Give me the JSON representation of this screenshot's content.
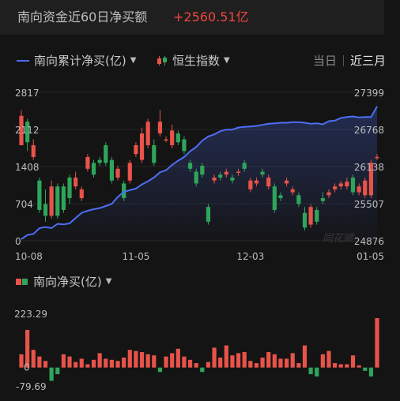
{
  "header": {
    "title": "南向资金近60日净买额",
    "value": "+2560.51亿"
  },
  "legend": {
    "line_label": "南向累计净买(亿)",
    "candle_label": "恒生指数",
    "bar_label": "南向净买(亿)"
  },
  "tabs": [
    {
      "label": "当日",
      "active": false
    },
    {
      "label": "近三月",
      "active": true
    }
  ],
  "watermark": "同花顺",
  "colors": {
    "line": "#4d6ef5",
    "up": "#e8534a",
    "down": "#2fa55c",
    "background": "#141414"
  },
  "chart_data": [
    {
      "type": "line",
      "name": "南向累计净买(亿)",
      "ylim": [
        0,
        2817
      ],
      "left_ticks": [
        "2817",
        "2112",
        "1408",
        "704",
        "0"
      ],
      "x_ticks": [
        "10-08",
        "11-05",
        "12-03",
        "01-05"
      ],
      "x_tick_index": [
        0,
        19,
        38,
        59
      ],
      "values": [
        30,
        110,
        130,
        240,
        260,
        240,
        320,
        310,
        330,
        430,
        530,
        570,
        600,
        620,
        660,
        700,
        830,
        930,
        960,
        990,
        1070,
        1130,
        1200,
        1300,
        1340,
        1440,
        1520,
        1590,
        1700,
        1780,
        1900,
        1980,
        2020,
        2080,
        2110,
        2110,
        2150,
        2160,
        2170,
        2180,
        2200,
        2220,
        2230,
        2240,
        2240,
        2250,
        2250,
        2240,
        2220,
        2230,
        2210,
        2270,
        2280,
        2330,
        2350,
        2360,
        2340,
        2350,
        2350,
        2550
      ]
    },
    {
      "type": "candlestick",
      "name": "恒生指数",
      "ylim": [
        24876,
        27399
      ],
      "right_ticks": [
        "27399",
        "26768",
        "26138",
        "25507",
        "24876"
      ],
      "ohlc": [
        [
          26500,
          27000,
          26550,
          27100
        ],
        [
          26900,
          26550,
          26400,
          26950
        ],
        [
          26300,
          26500,
          26250,
          26600
        ],
        [
          25900,
          25400,
          25350,
          25950
        ],
        [
          25500,
          25300,
          25200,
          25750
        ],
        [
          25300,
          25800,
          25250,
          25900
        ],
        [
          25800,
          25300,
          25250,
          25850
        ],
        [
          25800,
          25400,
          25350,
          25850
        ],
        [
          25950,
          25600,
          25500,
          26000
        ],
        [
          25800,
          25950,
          25750,
          26050
        ],
        [
          25600,
          25750,
          25550,
          25800
        ],
        [
          26100,
          26300,
          26050,
          26350
        ],
        [
          26200,
          26000,
          25950,
          26250
        ],
        [
          26250,
          26200,
          26150,
          26300
        ],
        [
          26500,
          26200,
          26150,
          26550
        ],
        [
          26250,
          25900,
          25850,
          26300
        ],
        [
          25950,
          26100,
          25900,
          26150
        ],
        [
          25850,
          25600,
          25550,
          25900
        ],
        [
          25900,
          26200,
          25850,
          26250
        ],
        [
          26350,
          26500,
          26300,
          26550
        ],
        [
          26250,
          26700,
          26200,
          26800
        ],
        [
          26500,
          26900,
          26450,
          26950
        ],
        [
          26500,
          26200,
          26150,
          26600
        ],
        [
          26700,
          26900,
          26650,
          27100
        ],
        [
          26600,
          26600,
          26550,
          26650
        ],
        [
          26500,
          26750,
          26450,
          26850
        ],
        [
          26700,
          26550,
          26500,
          26750
        ],
        [
          26600,
          26400,
          26350,
          26650
        ],
        [
          26200,
          26100,
          26050,
          26250
        ],
        [
          26050,
          25850,
          25800,
          26100
        ],
        [
          26150,
          26000,
          25950,
          26200
        ],
        [
          25450,
          25200,
          25150,
          25500
        ],
        [
          25900,
          25950,
          25850,
          26000
        ],
        [
          26000,
          25950,
          25900,
          26050
        ],
        [
          26000,
          26050,
          25950,
          26100
        ],
        [
          25950,
          25900,
          25850,
          26000
        ],
        [
          26050,
          26050,
          25980,
          26100
        ],
        [
          26200,
          26100,
          26050,
          26250
        ],
        [
          25750,
          25900,
          25700,
          25950
        ],
        [
          25850,
          25900,
          25800,
          25950
        ],
        [
          26050,
          26000,
          25950,
          26100
        ],
        [
          25800,
          25950,
          25750,
          26000
        ],
        [
          25800,
          25400,
          25350,
          25850
        ],
        [
          25650,
          25600,
          25550,
          25700
        ],
        [
          25850,
          25900,
          25800,
          25950
        ],
        [
          25700,
          25750,
          25650,
          25800
        ],
        [
          25650,
          25500,
          25450,
          25700
        ],
        [
          25350,
          25100,
          25050,
          25450
        ],
        [
          25150,
          25450,
          25100,
          25500
        ],
        [
          25400,
          25200,
          25150,
          25450
        ],
        [
          25600,
          25550,
          25500,
          25700
        ],
        [
          25650,
          25700,
          25600,
          25750
        ],
        [
          25750,
          25800,
          25700,
          25850
        ],
        [
          25800,
          25850,
          25750,
          25900
        ],
        [
          25800,
          25880,
          25750,
          25950
        ],
        [
          25950,
          25700,
          25650,
          26000
        ],
        [
          25700,
          25800,
          25650,
          25850
        ],
        [
          25650,
          25900,
          25600,
          25950
        ],
        [
          25650,
          26200,
          25600,
          26250
        ],
        [
          26300,
          26300,
          26250,
          26350
        ]
      ]
    },
    {
      "type": "bar",
      "name": "南向净买(亿)",
      "ylim": [
        -79.69,
        223.29
      ],
      "y_ticks": [
        "223.29",
        "0",
        "-79.69"
      ],
      "values": [
        60,
        170,
        80,
        50,
        30,
        -60,
        -30,
        60,
        50,
        25,
        40,
        15,
        35,
        65,
        40,
        35,
        30,
        45,
        80,
        75,
        70,
        60,
        55,
        -20,
        50,
        65,
        85,
        50,
        35,
        20,
        -20,
        25,
        90,
        45,
        100,
        55,
        65,
        70,
        30,
        20,
        45,
        70,
        60,
        40,
        40,
        65,
        20,
        100,
        -30,
        -40,
        60,
        75,
        20,
        15,
        15,
        55,
        10,
        -15,
        -40,
        223.29
      ]
    }
  ]
}
